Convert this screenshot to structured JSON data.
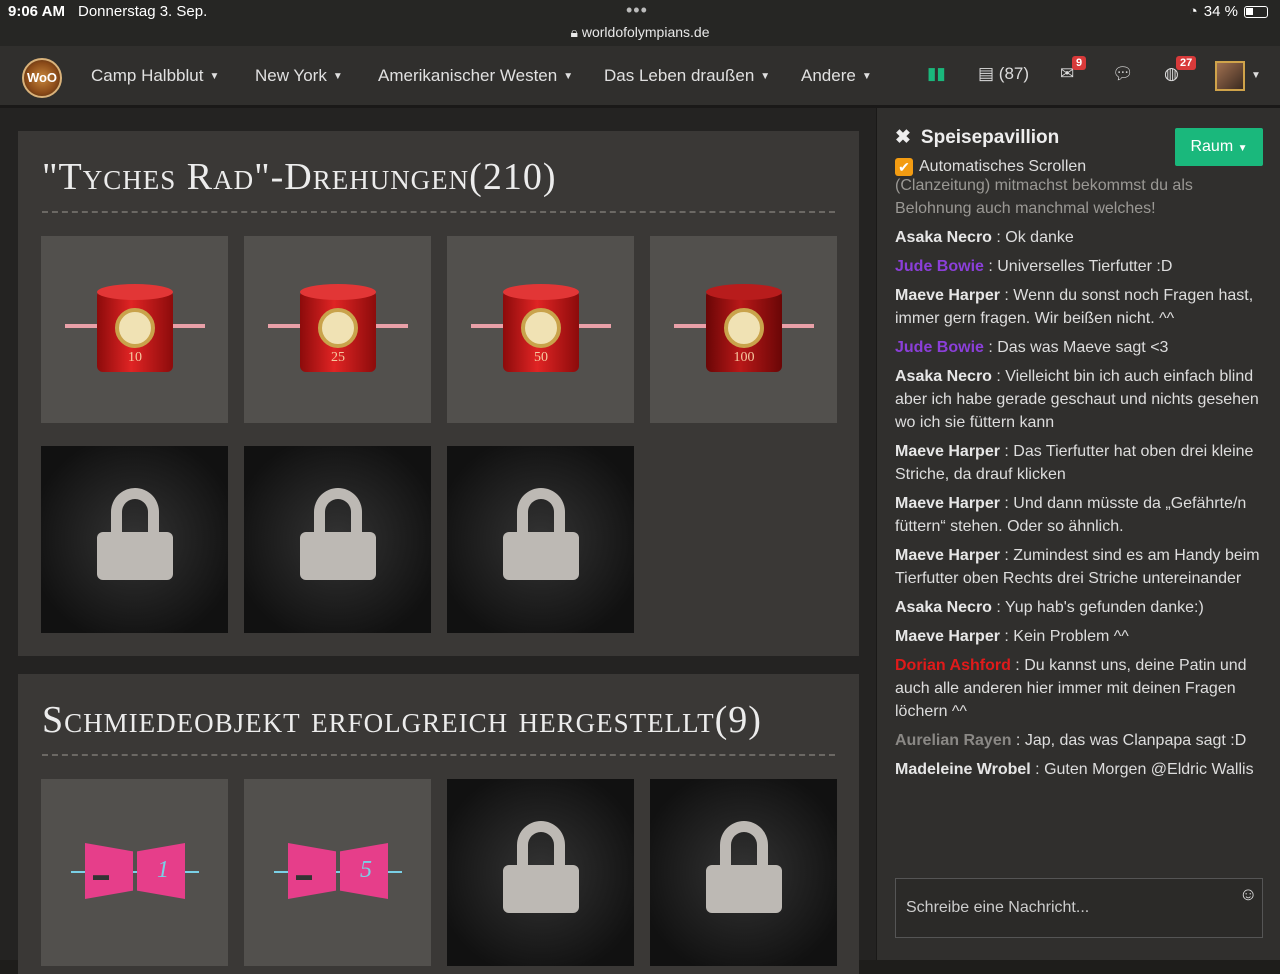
{
  "status": {
    "time": "9:06 AM",
    "date": "Donnerstag 3. Sep.",
    "url": "worldofolympians.de",
    "battery": "34 %"
  },
  "nav": {
    "logo": "WoO",
    "items": [
      "Camp Halbblut",
      "New York",
      "Amerikanischer Westen",
      "Das Leben draußen",
      "Andere"
    ],
    "docs_count": "(87)",
    "mail_badge": "9",
    "notif_badge": "27"
  },
  "panels": [
    {
      "title": "\"Tyches Rad\"-Drehungen(210)",
      "tiles": [
        {
          "locked": false,
          "num": "10"
        },
        {
          "locked": false,
          "num": "25"
        },
        {
          "locked": false,
          "num": "50"
        },
        {
          "locked": false,
          "num": "100"
        },
        {
          "locked": true
        },
        {
          "locked": true
        },
        {
          "locked": true
        }
      ]
    },
    {
      "title": "Schmiedeobjekt erfolgreich hergestellt(9)",
      "tiles": [
        {
          "locked": false,
          "num": "1"
        },
        {
          "locked": false,
          "num": "5"
        },
        {
          "locked": true
        },
        {
          "locked": true
        }
      ]
    }
  ],
  "chat": {
    "room": "Speisepavillion",
    "auto_scroll": "Automatisches Scrollen",
    "room_button": "Raum",
    "placeholder": "Schreibe eine Nachricht...",
    "messages": [
      {
        "name": "",
        "text": "(Clanzeitung) mitmachst bekommst du als Belohnung auch manchmal welches!",
        "style": "faded"
      },
      {
        "name": "Asaka Necro",
        "text": " : Ok danke",
        "style": ""
      },
      {
        "name": "Jude Bowie",
        "text": " : Universelles Tierfutter :D",
        "style": "purple"
      },
      {
        "name": "Maeve Harper",
        "text": " : Wenn du sonst noch Fragen hast, immer gern fragen. Wir beißen nicht. ^^",
        "style": ""
      },
      {
        "name": "Jude Bowie",
        "text": " : Das was Maeve sagt <3",
        "style": "purple"
      },
      {
        "name": "Asaka Necro",
        "text": " : Vielleicht bin ich auch einfach blind aber ich habe gerade geschaut und nichts gesehen wo ich sie füttern kann",
        "style": ""
      },
      {
        "name": "Maeve Harper",
        "text": " : Das Tierfutter hat oben drei kleine Striche, da drauf klicken",
        "style": ""
      },
      {
        "name": "Maeve Harper",
        "text": " : Und dann müsste da „Gefährte/n füttern“ stehen. Oder so ähnlich.",
        "style": ""
      },
      {
        "name": "Maeve Harper",
        "text": " : Zumindest sind es am Handy beim Tierfutter oben Rechts drei Striche untereinander",
        "style": ""
      },
      {
        "name": "Asaka Necro",
        "text": " : Yup hab's gefunden danke:)",
        "style": ""
      },
      {
        "name": "Maeve Harper",
        "text": " : Kein Problem ^^",
        "style": ""
      },
      {
        "name": "Dorian Ashford",
        "text": " : Du kannst uns, deine Patin und auch alle anderen hier immer mit deinen Fragen löchern ^^",
        "style": "red"
      },
      {
        "name": "Aurelian Rayen",
        "text": " : Jap, das was Clanpapa sagt :D",
        "style": "gray"
      },
      {
        "name": "Madeleine Wrobel",
        "text": " : Guten Morgen @Eldric Wallis",
        "style": ""
      }
    ]
  }
}
